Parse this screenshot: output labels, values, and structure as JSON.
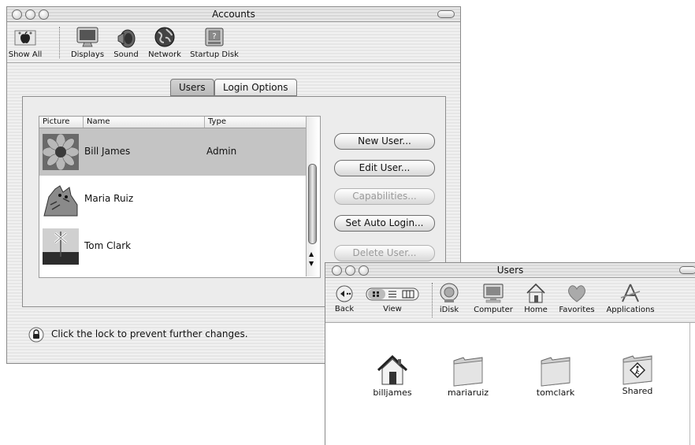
{
  "accounts_window": {
    "title": "Accounts",
    "toolbar": [
      {
        "label": "Show All",
        "icon": "apple-icon"
      },
      {
        "label": "Displays",
        "icon": "display-icon"
      },
      {
        "label": "Sound",
        "icon": "speaker-icon"
      },
      {
        "label": "Network",
        "icon": "globe-icon"
      },
      {
        "label": "Startup Disk",
        "icon": "disk-icon"
      }
    ],
    "tabs": [
      "Users",
      "Login Options"
    ],
    "selected_tab": "Users",
    "columns": [
      "Picture",
      "Name",
      "Type"
    ],
    "users": [
      {
        "name": "Bill James",
        "type": "Admin",
        "picture": "flower-picture-icon",
        "selected": true
      },
      {
        "name": "Maria Ruiz",
        "type": "",
        "picture": "cat-picture-icon",
        "selected": false
      },
      {
        "name": "Tom Clark",
        "type": "",
        "picture": "crossing-picture-icon",
        "selected": false
      }
    ],
    "buttons": {
      "new_user": "New User...",
      "edit_user": "Edit User...",
      "capabilities": "Capabilities...",
      "auto_login": "Set Auto Login...",
      "delete_user": "Delete User..."
    },
    "lock_text": "Click the lock to prevent further changes."
  },
  "users_window": {
    "title": "Users",
    "toolbar": {
      "back": "Back",
      "view": "View",
      "idisk": "iDisk",
      "computer": "Computer",
      "home": "Home",
      "favorites": "Favorites",
      "applications": "Applications"
    },
    "items": [
      {
        "label": "billjames",
        "icon": "home-icon"
      },
      {
        "label": "mariaruiz",
        "icon": "folder-icon"
      },
      {
        "label": "tomclark",
        "icon": "folder-icon"
      },
      {
        "label": "Shared",
        "icon": "shared-folder-icon"
      }
    ]
  }
}
